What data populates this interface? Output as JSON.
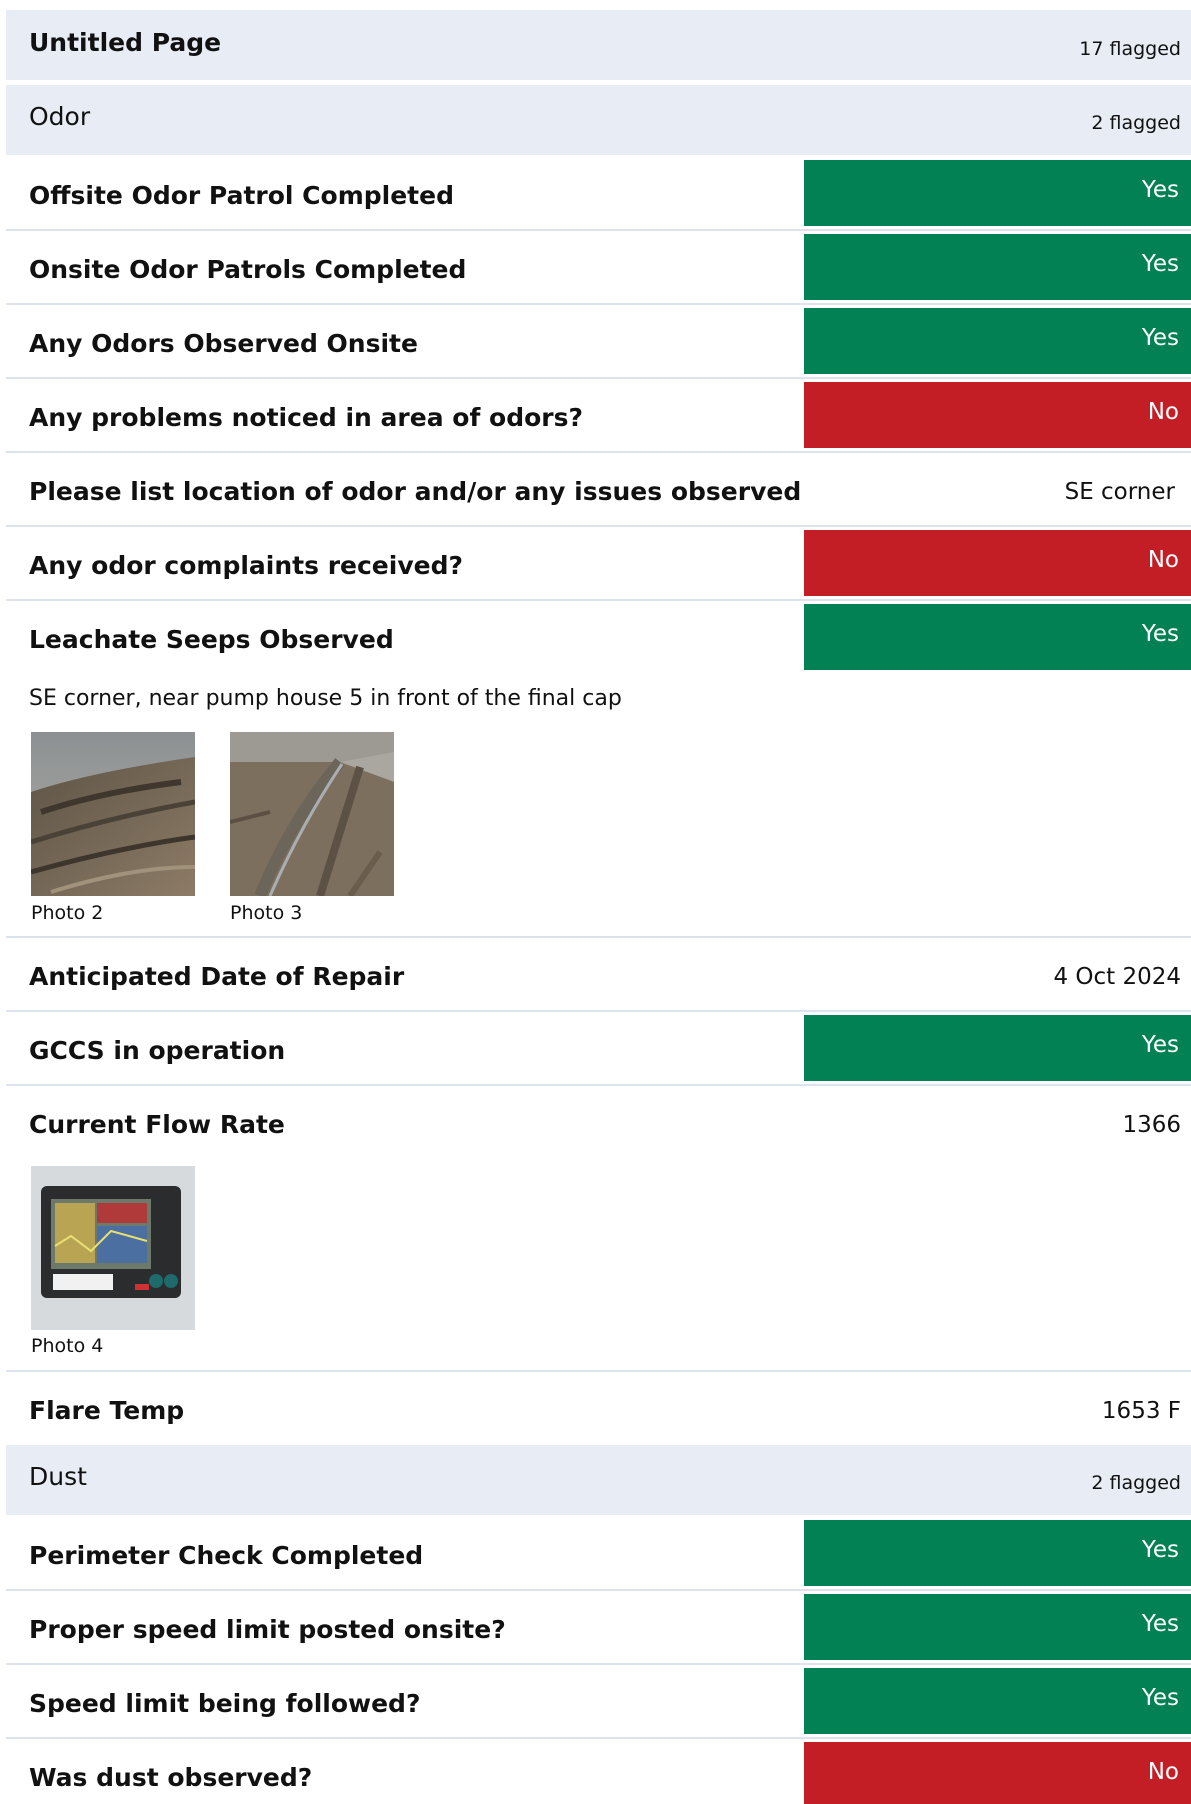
{
  "header": {
    "title": "Untitled Page",
    "flagged": "17 flagged"
  },
  "odor": {
    "title": "Odor",
    "flagged": "2 flagged",
    "q1": {
      "label": "Offsite Odor Patrol Completed",
      "value": "Yes"
    },
    "q2": {
      "label": "Onsite Odor Patrols Completed",
      "value": "Yes"
    },
    "q3": {
      "label": "Any Odors Observed Onsite",
      "value": "Yes"
    },
    "q4": {
      "label": "Any problems noticed in area of odors?",
      "value": "No"
    },
    "q5": {
      "label": "Please list location of odor and/or any issues observed",
      "value": "SE corner"
    },
    "q6": {
      "label": "Any odor complaints received?",
      "value": "No"
    },
    "q7": {
      "label": "Leachate Seeps Observed",
      "value": "Yes",
      "note": "SE corner, near pump house 5 in front of the final cap",
      "photo_a": "Photo 2",
      "photo_b": "Photo 3"
    },
    "q8": {
      "label": "Anticipated Date of Repair",
      "value": "4 Oct 2024"
    },
    "q9": {
      "label": "GCCS in operation",
      "value": "Yes"
    },
    "q10": {
      "label": "Current Flow Rate",
      "value": "1366",
      "photo": "Photo 4"
    },
    "q11": {
      "label": "Flare Temp",
      "value": "1653 F"
    }
  },
  "dust": {
    "title": "Dust",
    "flagged": "2 flagged",
    "q1": {
      "label": "Perimeter Check Completed",
      "value": "Yes"
    },
    "q2": {
      "label": "Proper speed limit posted onsite?",
      "value": "Yes"
    },
    "q3": {
      "label": "Speed limit being followed?",
      "value": "Yes"
    },
    "q4": {
      "label": "Was dust observed?",
      "value": "No"
    }
  },
  "colors": {
    "yes": "#028155",
    "no": "#c31e26",
    "section_bg": "#e8edf5"
  }
}
